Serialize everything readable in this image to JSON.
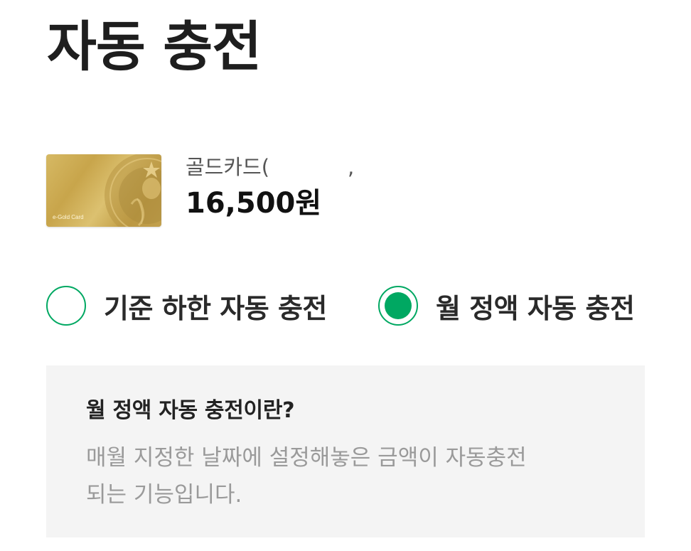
{
  "header": {
    "title": "자동 충전"
  },
  "card": {
    "image_text": "e-Gold Card",
    "name": "골드카드(",
    "name_tail": ",",
    "balance": "16,500원"
  },
  "options": [
    {
      "label": "기준 하한 자동 충전",
      "selected": false
    },
    {
      "label": "월 정액 자동 충전",
      "selected": true
    }
  ],
  "info": {
    "title": "월 정액 자동 충전이란?",
    "description_line1": "매월 지정한 날짜에 설정해놓은 금액이 자동충전",
    "description_line2": "되는 기능입니다."
  },
  "colors": {
    "accent": "#00a862",
    "info_bg": "#f4f4f4",
    "card_gold": "#c8a54b"
  },
  "icons": {
    "radio_unselected": "radio-empty-icon",
    "radio_selected": "radio-filled-icon",
    "card_logo": "siren-logo-icon"
  }
}
